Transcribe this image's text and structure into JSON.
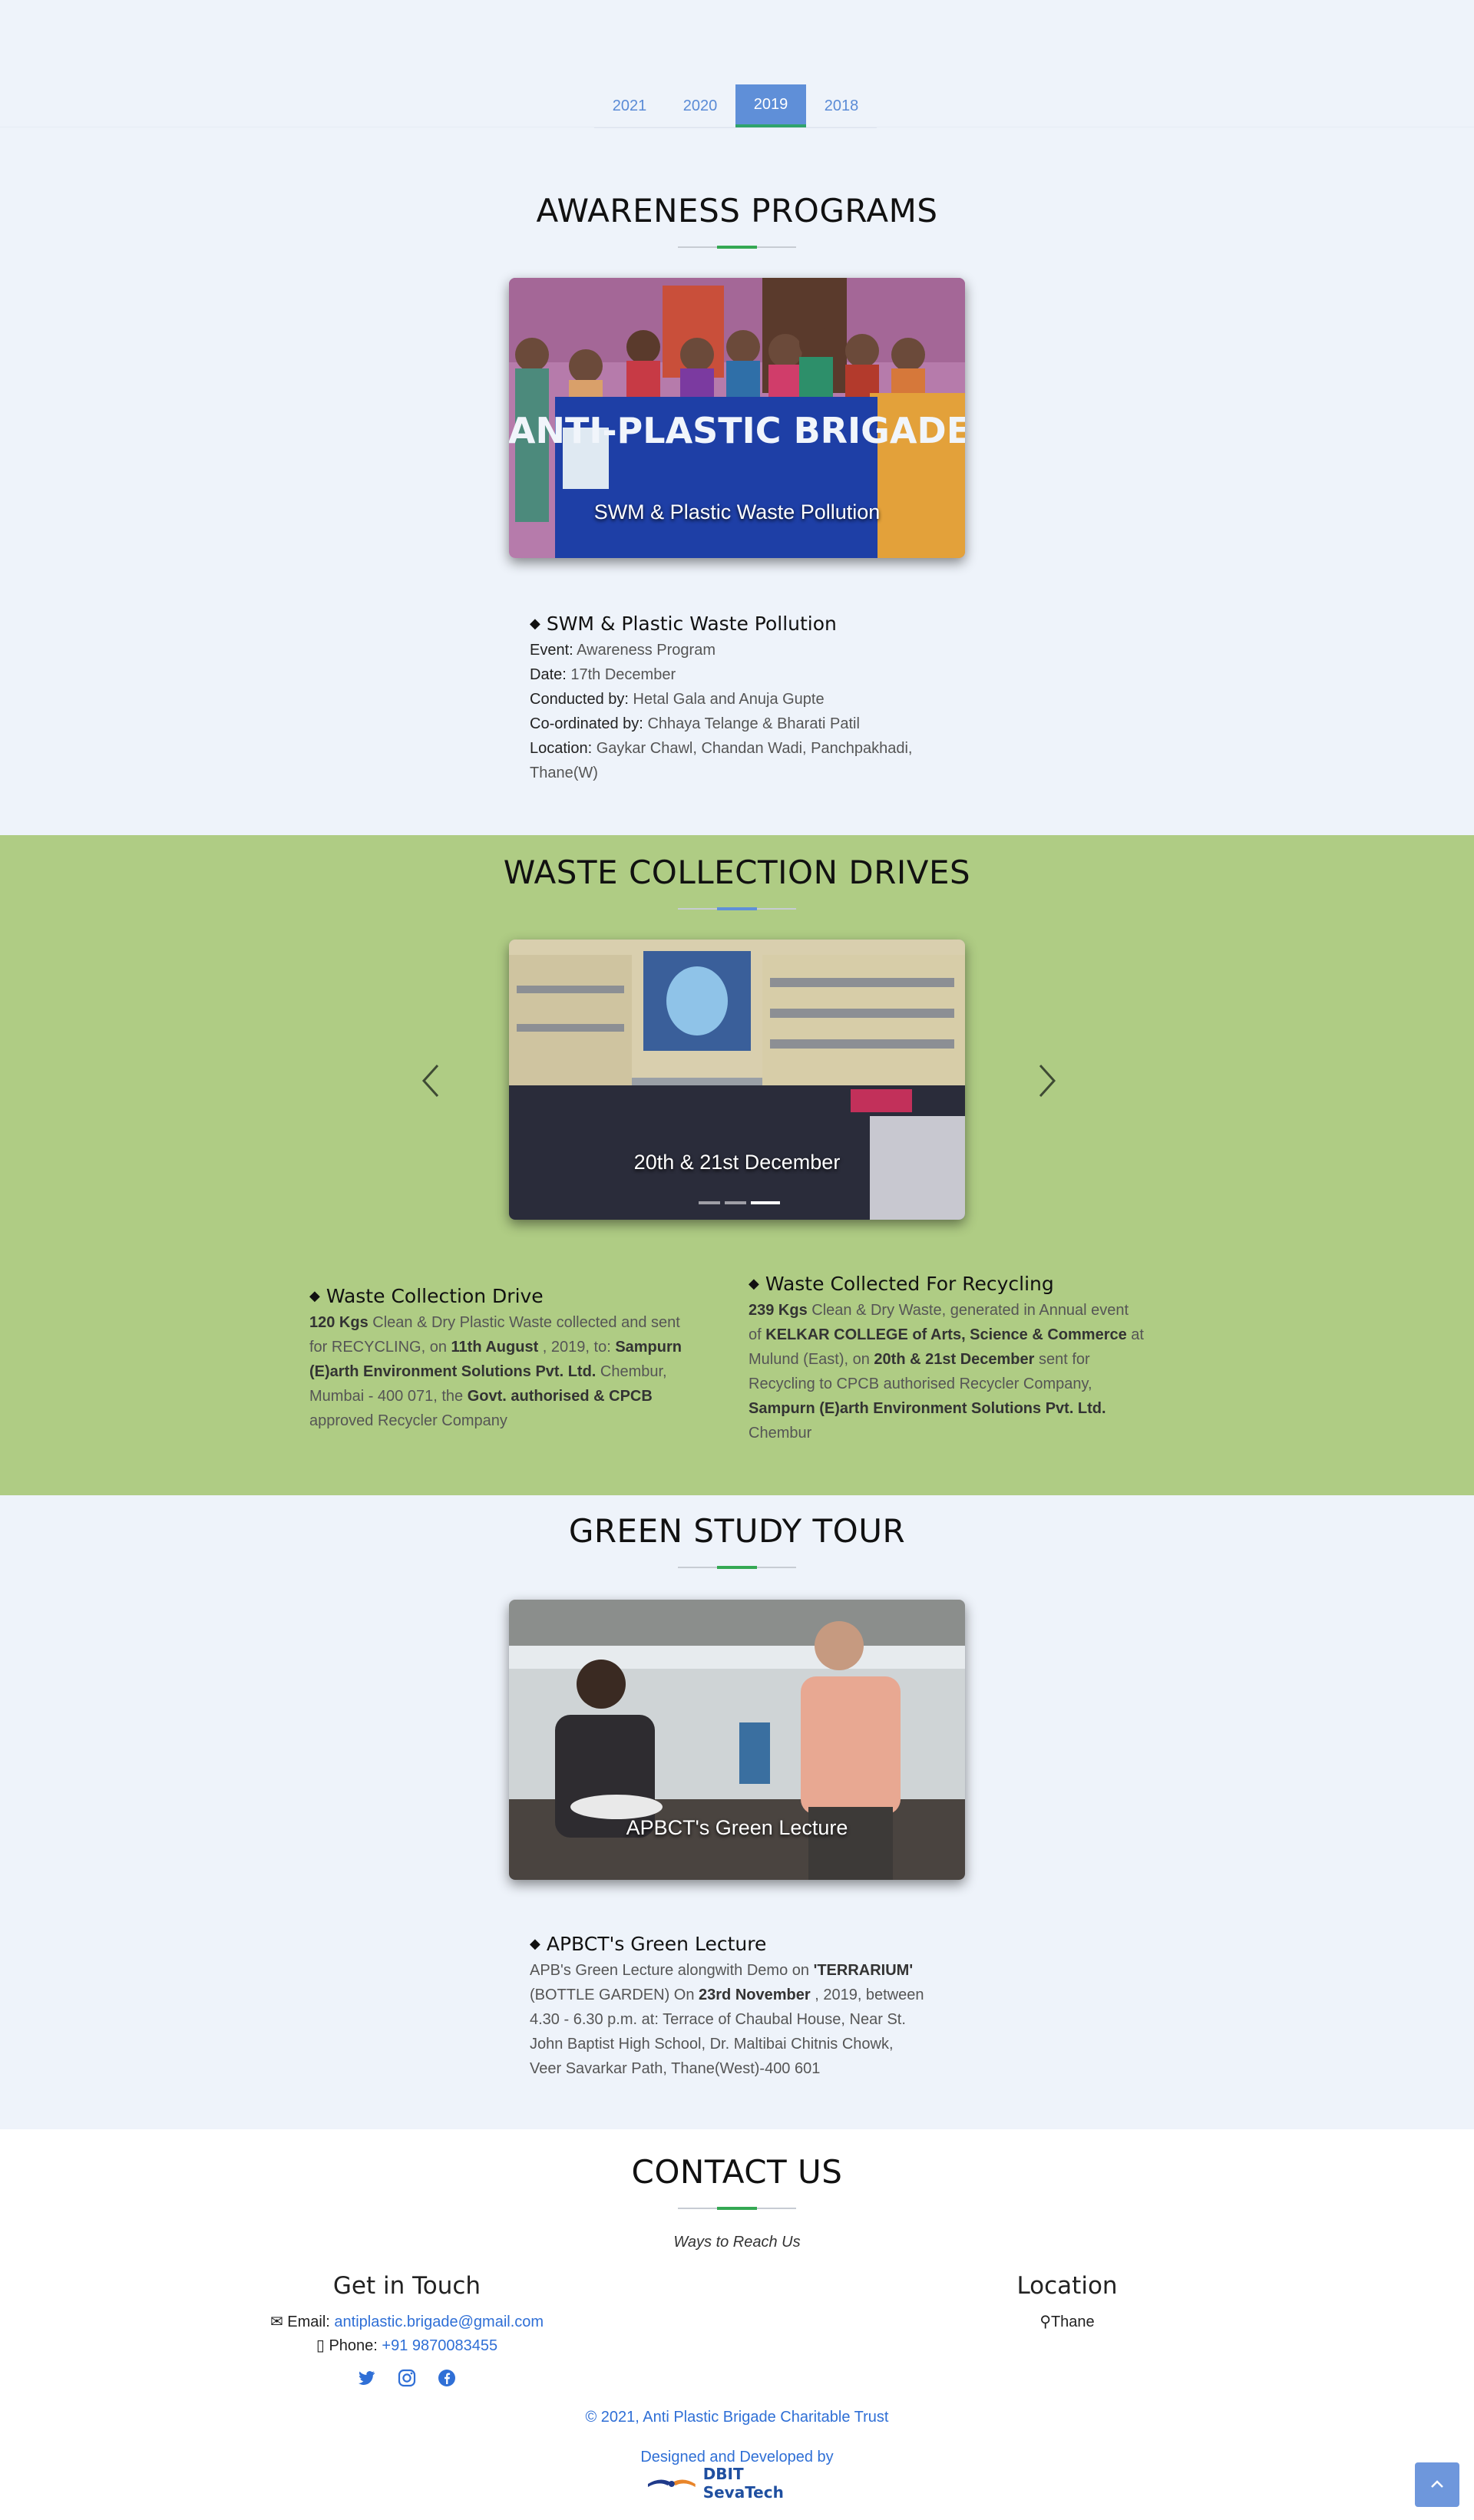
{
  "tabs": [
    "2021",
    "2020",
    "2019",
    "2018"
  ],
  "active_tab": "2019",
  "awareness": {
    "title": "AWARENESS PROGRAMS",
    "photo_caption": "SWM & Plastic Waste Pollution",
    "banner_text": "ANTI-PLASTIC BRIGADE",
    "card_title": "SWM & Plastic Waste Pollution",
    "event_label": "Event:",
    "event": "Awareness Program",
    "date_label": "Date:",
    "date": "17th December",
    "conducted_label": "Conducted by:",
    "conducted": "Hetal Gala and Anuja Gupte",
    "coord_label": "Co-ordinated by:",
    "coord": "Chhaya Telange & Bharati Patil",
    "location_label": "Location:",
    "location_1": "Gaykar Chawl, Chandan Wadi, Panchpakhadi,",
    "location_2": "Thane(W)"
  },
  "waste": {
    "title": "WASTE COLLECTION DRIVES",
    "photo_caption": "20th & 21st December",
    "left": {
      "title": "Waste Collection Drive",
      "l1a": "120 Kgs",
      "l1b": " Clean & Dry Plastic Waste collected and sent",
      "l2a": "for RECYCLING, on ",
      "l2b": "11th August",
      "l2c": " , 2019, to: ",
      "l2d": "Sampurn",
      "l3a": "(E)arth Environment Solutions Pvt. Ltd.",
      "l3b": " Chembur,",
      "l4a": "Mumbai - 400 071, the ",
      "l4b": "Govt. authorised & CPCB",
      "l5": "approved Recycler Company"
    },
    "right": {
      "title": "Waste Collected For Recycling",
      "l1a": "239 Kgs",
      "l1b": " Clean & Dry Waste, generated in Annual event",
      "l2a": "of ",
      "l2b": "KELKAR COLLEGE of Arts, Science & Commerce",
      "l2c": " at",
      "l3a": "Mulund (East), on ",
      "l3b": "20th & 21st December",
      "l3c": " sent for",
      "l4": "Recycling to CPCB authorised Recycler Company,",
      "l5": "Sampurn (E)arth Environment Solutions Pvt. Ltd.",
      "l6": "Chembur"
    }
  },
  "tour": {
    "title": "GREEN STUDY TOUR",
    "photo_caption": "APBCT's Green Lecture",
    "card_title": "APBCT's Green Lecture",
    "l1a": "APB's Green Lecture alongwith Demo on ",
    "l1b": "'TERRARIUM'",
    "l2a": "(BOTTLE GARDEN) On ",
    "l2b": "23rd November",
    "l2c": " , 2019, between",
    "l3": "4.30 - 6.30 p.m. at: Terrace of Chaubal House, Near St.",
    "l4": "John Baptist High School, Dr. Maltibai Chitnis Chowk,",
    "l5": "Veer Savarkar Path, Thane(West)-400 601"
  },
  "contact": {
    "title": "CONTACT US",
    "subtitle": "Ways to Reach Us",
    "get_in_touch": "Get in Touch",
    "email_label": "Email:",
    "email": "antiplastic.brigade@gmail.com",
    "phone_label": "Phone:",
    "phone": "+91 9870083455",
    "location_title": "Location",
    "location": "Thane"
  },
  "footer": {
    "copyright": "© 2021, Anti Plastic Brigade Charitable Trust",
    "designed": "Designed and Developed by",
    "brand": "DBIT SevaTech"
  },
  "colors": {
    "accent": "#5f8fd8",
    "green": "#34a853",
    "band": "#afcc84",
    "link": "#2f6fd6"
  }
}
